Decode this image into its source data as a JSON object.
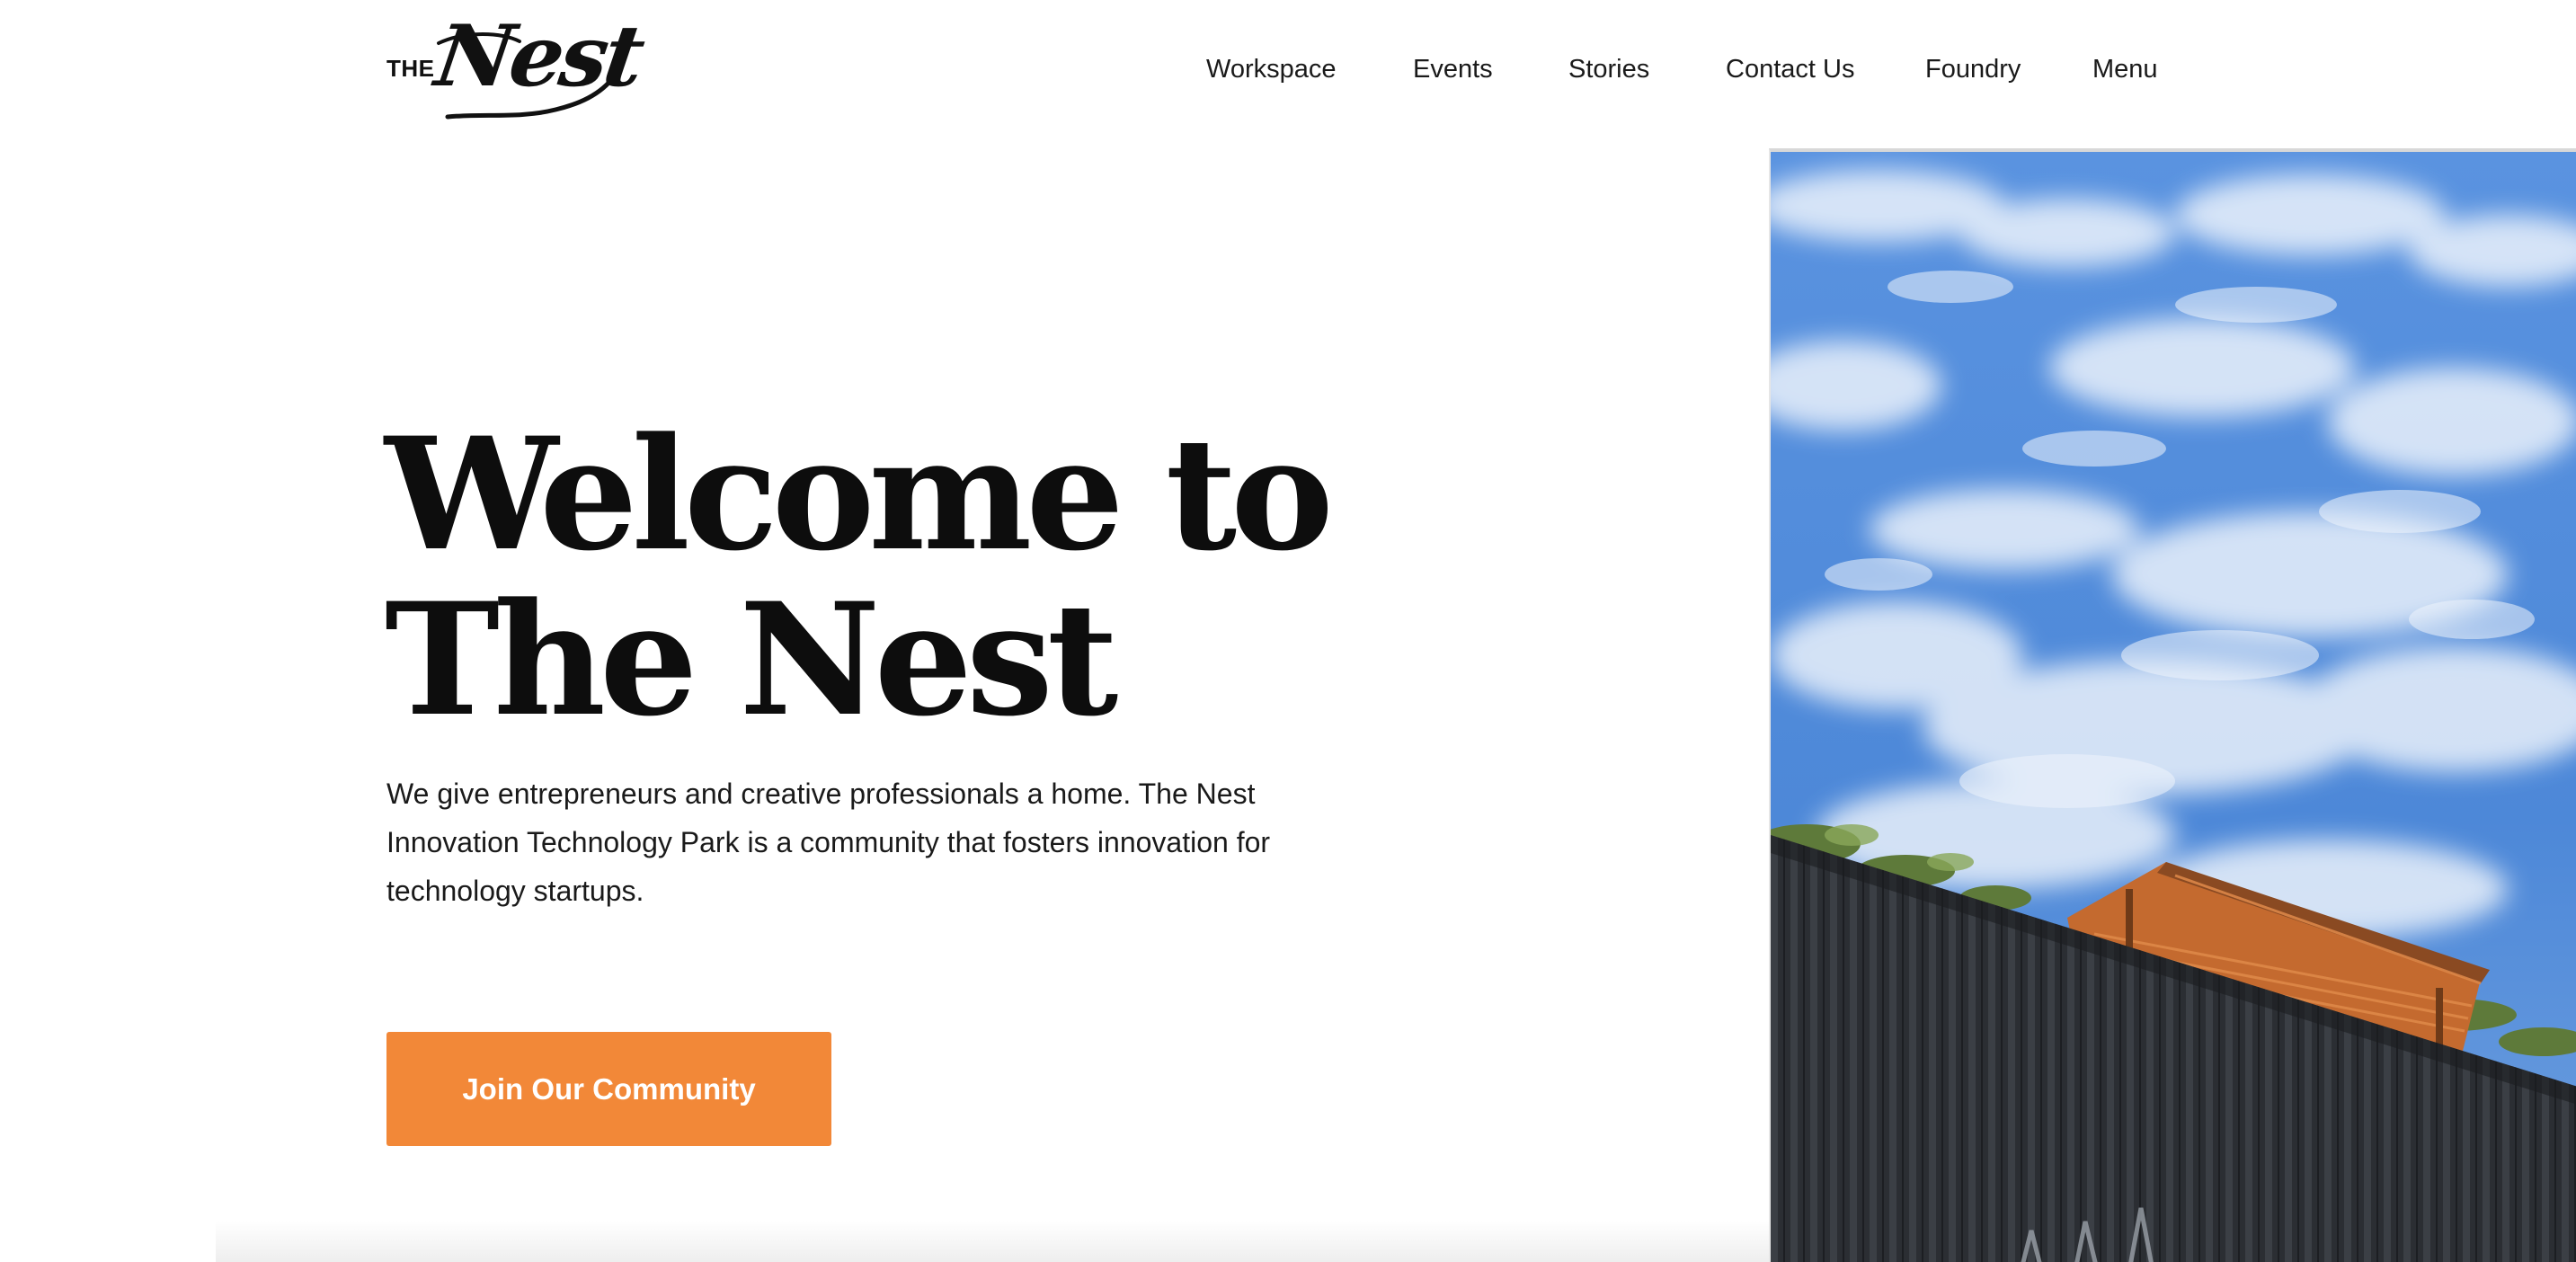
{
  "brand": {
    "logo_prefix": "THE",
    "logo_name": "Nest"
  },
  "nav": {
    "items": [
      {
        "label": "Workspace"
      },
      {
        "label": "Events"
      },
      {
        "label": "Stories"
      },
      {
        "label": "Contact Us"
      },
      {
        "label": "Foundry"
      },
      {
        "label": "Menu"
      }
    ]
  },
  "hero": {
    "title_line1": "Welcome to",
    "title_line2": "The Nest",
    "description": "We give entrepreneurs and creative professionals a home. The Nest Innovation Technology Park is a community that fosters innovation for technology startups.",
    "cta_label": "Join Our Community"
  },
  "colors": {
    "accent": "#f28838",
    "text": "#111111",
    "background": "#ffffff",
    "sky": "#4a86d8"
  },
  "icons": {
    "hero_image": "building-under-sky-photo"
  }
}
